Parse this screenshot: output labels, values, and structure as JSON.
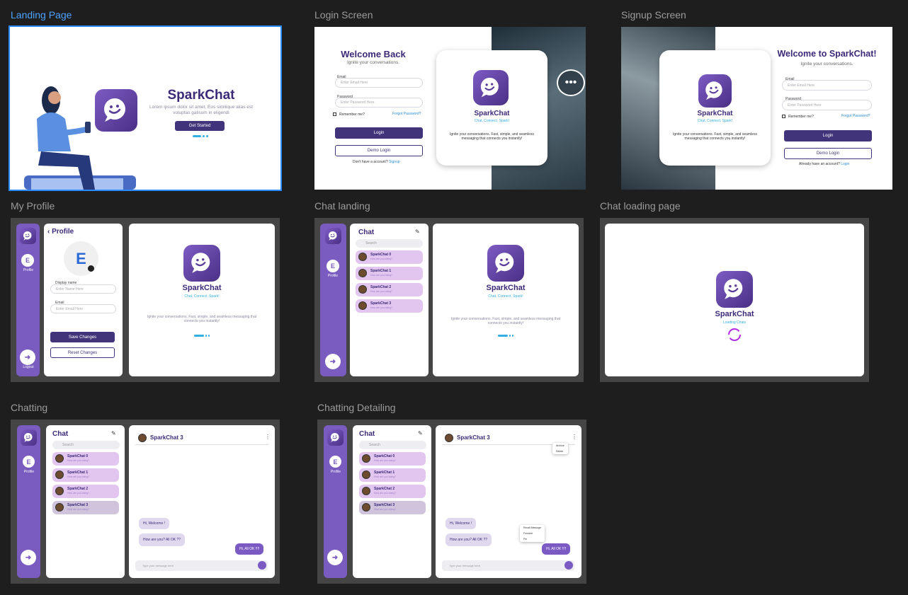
{
  "frames": {
    "landing": "Landing Page",
    "login": "Login Screen",
    "signup": "Signup Screen",
    "profile": "My Profile",
    "chat_landing": "Chat landing",
    "chat_loading": "Chat loading page",
    "chatting": "Chatting",
    "chatting_detail": "Chatting Detailing"
  },
  "brand": {
    "name": "SparkChat",
    "tagline": "Chat, Connect, Spark!",
    "description": "Ignite your conversations. Fast, simple, and seamless messaging that connects you instantly!",
    "loading": "Loading Chats"
  },
  "landing": {
    "lorem": "Lorem ipsum dolor sit amet. Eos similique alias est voluptas galisum in eligendi",
    "cta": "Get Started"
  },
  "login": {
    "title": "Welcome Back",
    "subtitle": "Ignite your conversations.",
    "email_label": "Email",
    "email_placeholder": "Enter Email Here",
    "password_label": "Password",
    "password_placeholder": "Enter Password Here",
    "remember": "Remember me?",
    "forgot": "Forgot Password?",
    "login_btn": "Login",
    "demo_btn": "Demo Login",
    "footer": "Don't have a account?",
    "footer_link": "Signup"
  },
  "signup": {
    "title": "Welcome to SparkChat!",
    "subtitle": "Ignite your conversations.",
    "email_label": "Email",
    "email_placeholder": "Enter Email Here",
    "password_label": "Password",
    "password_placeholder": "Enter Password Here",
    "remember": "Remember me?",
    "forgot": "Forgot Password?",
    "login_btn": "Login",
    "demo_btn": "Demo Login",
    "footer": "Already have an account?",
    "footer_link": "Login"
  },
  "sidebar": {
    "avatar_letter": "E",
    "profile": "Profile",
    "logout": "Logout"
  },
  "profile": {
    "title": "Profile",
    "avatar_letter": "E",
    "name_label": "Display name",
    "name_placeholder": "Enter Name Here",
    "email_label": "Email",
    "email_placeholder": "Enter Email Here",
    "save": "Save Changes",
    "reset": "Reset Changes"
  },
  "chat": {
    "title": "Chat",
    "search": "Search",
    "items": [
      {
        "name": "SparkChat 0",
        "sub": "How are you doing?"
      },
      {
        "name": "SparkChat 1",
        "sub": "How are you doing?"
      },
      {
        "name": "SparkChat 2",
        "sub": "How are you doing?"
      },
      {
        "name": "SparkChat 3",
        "sub": "How are you doing?"
      }
    ]
  },
  "conversation": {
    "header": "SparkChat 3",
    "messages": [
      {
        "text": "Hi, Welcome !",
        "dir": "in"
      },
      {
        "text": "How are you? All OK ??",
        "dir": "in"
      },
      {
        "text": "Hi, All OK !!!!",
        "dir": "out"
      }
    ],
    "input_placeholder": "Type your message here",
    "header_menu": [
      "Archive",
      "Delete"
    ],
    "message_menu": [
      "Recall Message",
      "Forward",
      "Pin"
    ]
  }
}
